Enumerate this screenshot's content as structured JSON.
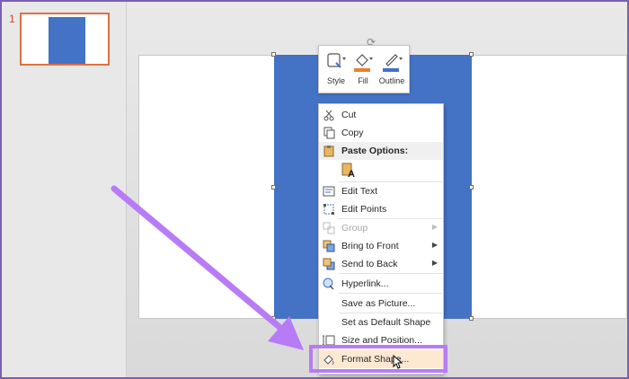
{
  "thumbnails": [
    {
      "number": "1"
    }
  ],
  "mini_toolbar": {
    "items": [
      {
        "label": "Style",
        "icon": "shape-style-icon"
      },
      {
        "label": "Fill",
        "icon": "paint-bucket-icon",
        "color": "#ed7d31"
      },
      {
        "label": "Outline",
        "icon": "pen-outline-icon",
        "color": "#4472c4"
      }
    ]
  },
  "context_menu": {
    "cut": "Cut",
    "copy": "Copy",
    "paste_options": "Paste Options:",
    "edit_text": "Edit Text",
    "edit_points": "Edit Points",
    "group": "Group",
    "bring_to_front": "Bring to Front",
    "send_to_back": "Send to Back",
    "hyperlink": "Hyperlink...",
    "save_as_picture": "Save as Picture...",
    "set_default_shape": "Set as Default Shape",
    "size_and_position": "Size and Position...",
    "format_shape": "Format Shape..."
  },
  "colors": {
    "shape": "#4472c4",
    "highlight": "#b77cf5",
    "thumb_border": "#e07040"
  }
}
